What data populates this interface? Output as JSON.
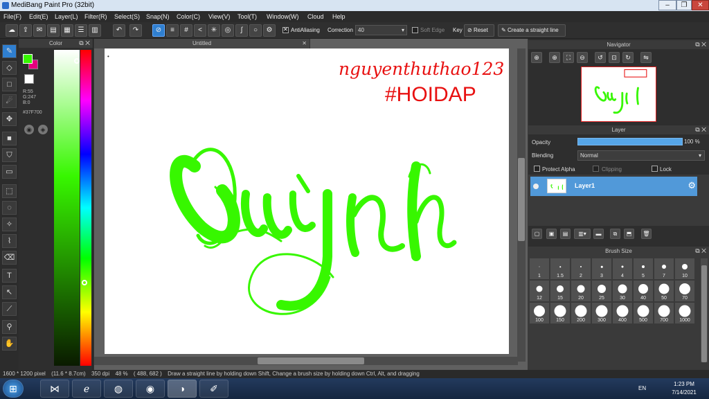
{
  "window": {
    "title": "MediBang Paint Pro (32bit)",
    "controls": {
      "minimize": "–",
      "maximize": "❐",
      "close": "✕"
    }
  },
  "menu": [
    "File(F)",
    "Edit(E)",
    "Layer(L)",
    "Filter(R)",
    "Select(S)",
    "Snap(N)",
    "Color(C)",
    "View(V)",
    "Tool(T)",
    "Window(W)",
    "Cloud",
    "Help"
  ],
  "toolbar": {
    "antialiasing_label": "AntiAliasing",
    "correction_label": "Correction",
    "correction_value": "40",
    "soft_edge_label": "Soft Edge",
    "key_label": "Key",
    "reset_label": "Reset",
    "straight_line_label": "Create a straight line"
  },
  "color_panel": {
    "title": "Color",
    "r": "R:55",
    "g": "G:247",
    "b": "B:0",
    "hex": "#37F700",
    "fg_color": "#37F700",
    "bg_color": "#e6007e"
  },
  "canvas": {
    "tab_title": "Untitled",
    "tab_close": "✕",
    "drawing_text": "Quỳnh",
    "watermark_line1": "nguyenthuthao123",
    "watermark_line2": "#HOIDAP",
    "stroke_color": "#37F700",
    "watermark_color": "#e81010"
  },
  "navigator": {
    "title": "Navigator"
  },
  "layer_panel": {
    "title": "Layer",
    "opacity_label": "Opacity",
    "opacity_value": "100 %",
    "opacity": 1.0,
    "blending_label": "Blending",
    "blending_value": "Normal",
    "protect_alpha_label": "Protect Alpha",
    "clipping_label": "Clipping",
    "lock_label": "Lock",
    "layers": [
      {
        "name": "Layer1"
      }
    ]
  },
  "brush_size": {
    "title": "Brush Size",
    "sizes": [
      "1",
      "1.5",
      "2",
      "3",
      "4",
      "5",
      "7",
      "10",
      "12",
      "15",
      "20",
      "25",
      "30",
      "40",
      "50",
      "70",
      "100",
      "150",
      "200",
      "300",
      "400",
      "500",
      "700",
      "1000"
    ]
  },
  "statusbar": {
    "dimensions": "1600 * 1200 pixel",
    "physical": "(11.6 * 8.7cm)",
    "dpi": "350 dpi",
    "zoom": "48 %",
    "cursor": "( 488, 682 )",
    "hint": "Draw a straight line by holding down Shift, Change a brush size by holding down Ctrl, Alt, and dragging"
  },
  "taskbar": {
    "language": "EN",
    "time": "1:23 PM",
    "date": "7/14/2021"
  }
}
